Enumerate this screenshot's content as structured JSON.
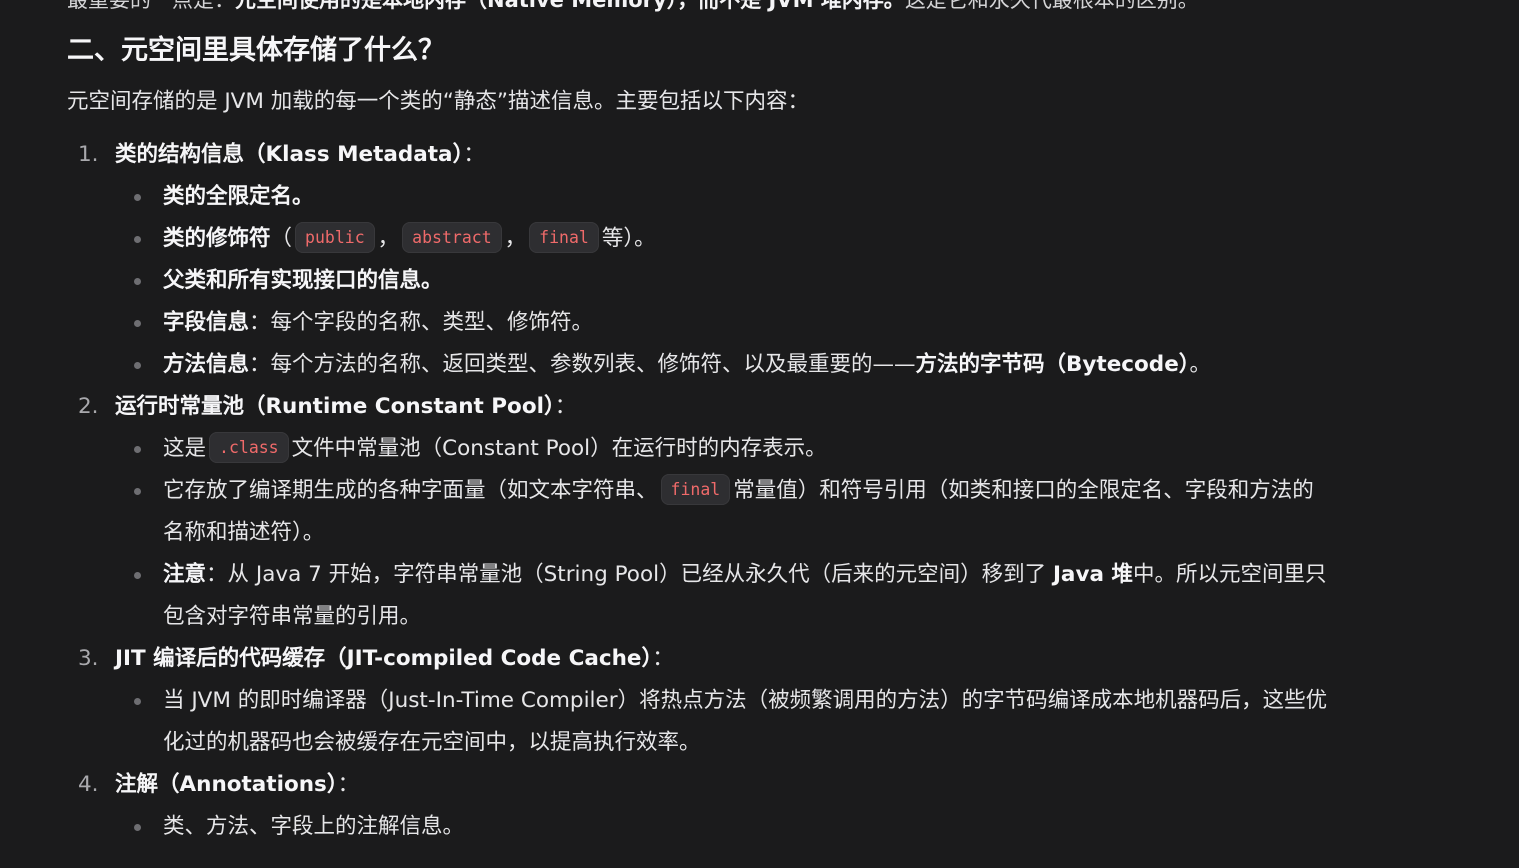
{
  "clipped_top": {
    "pre": "最重要的一点是：",
    "bold": "元空间使用的是本地内存（Native Memory），而不是 JVM 堆内存。",
    "post": "这是它和永久代最根本的区别。"
  },
  "heading": "二、元空间里具体存储了什么？",
  "intro": "元空间存储的是 JVM 加载的每一个类的“静态”描述信息。主要包括以下内容：",
  "items": [
    {
      "number": "1.",
      "title": "类的结构信息（Klass Metadata）",
      "colon": "：",
      "sub": {
        "s1": "类的全限定名。",
        "s2": {
          "bold": "类的修饰符",
          "open": "（",
          "codes": [
            "public",
            "abstract",
            "final"
          ],
          "sep": "，",
          "tail": "等）。"
        },
        "s3": "父类和所有实现接口的信息。",
        "s4": {
          "bold": "字段信息",
          "text": "：每个字段的名称、类型、修饰符。"
        },
        "s5": {
          "bold": "方法信息",
          "text": "：每个方法的名称、返回类型、参数列表、修饰符、以及最重要的——",
          "bold2": "方法的字节码（Bytecode）",
          "tail": "。"
        }
      }
    },
    {
      "number": "2.",
      "title": "运行时常量池（Runtime Constant Pool）",
      "colon": "：",
      "sub": {
        "s1": {
          "pre": "这是",
          "code": ".class",
          "post": "文件中常量池（Constant Pool）在运行时的内存表示。"
        },
        "s2": {
          "pre": "它存放了编译期生成的各种字面量（如文本字符串、",
          "code": "final",
          "post": "常量值）和符号引用（如类和接口的全限定名、字段和方法的",
          "cont": "名称和描述符）。"
        },
        "s3": {
          "bold": "注意",
          "text": "：从 Java 7 开始，字符串常量池（String Pool）已经从永久代（后来的元空间）移到了 ",
          "bold2": "Java 堆",
          "tail": "中。所以元空间里只",
          "cont": "包含对字符串常量的引用。"
        }
      }
    },
    {
      "number": "3.",
      "title": "JIT 编译后的代码缓存（JIT-compiled Code Cache）",
      "colon": "：",
      "sub": {
        "s1": {
          "text": "当 JVM 的即时编译器（Just-In-Time Compiler）将热点方法（被频繁调用的方法）的字节码编译成本地机器码后，这些优",
          "cont": "化过的机器码也会被缓存在元空间中，以提高执行效率。"
        }
      }
    },
    {
      "number": "4.",
      "title": "注解（Annotations）",
      "colon": "：",
      "sub": {
        "s1": "类、方法、字段上的注解信息。"
      }
    }
  ]
}
